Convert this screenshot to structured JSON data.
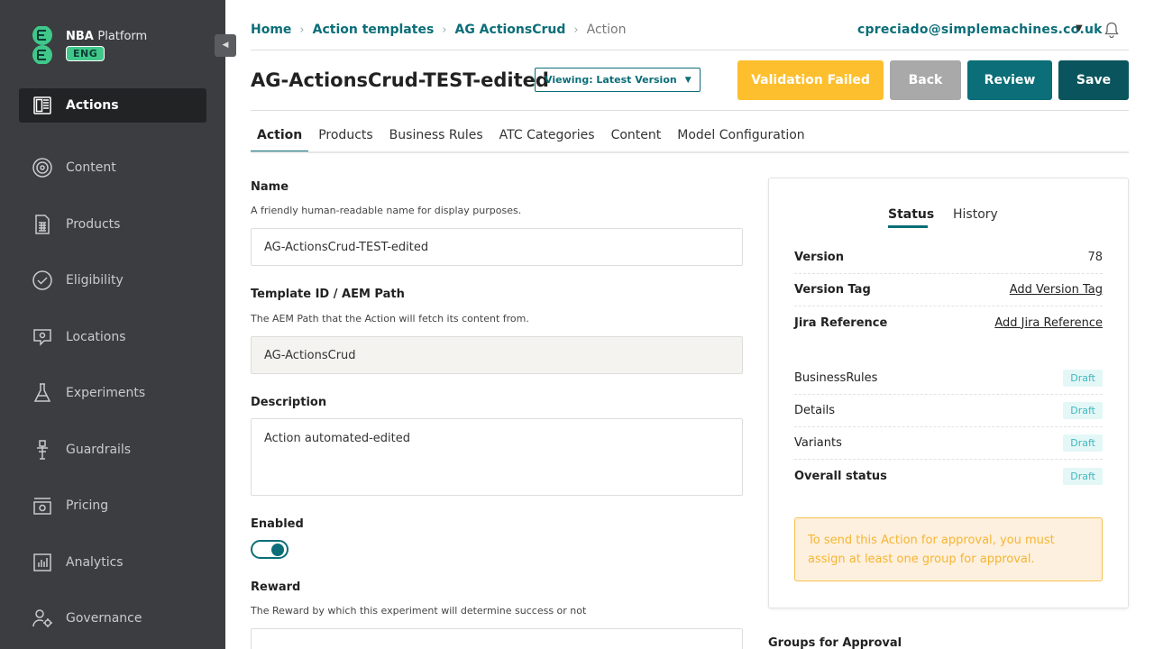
{
  "brand": {
    "name_bold": "NBA",
    "name_light": "Platform",
    "badge": "ENG"
  },
  "sidebar": {
    "items": [
      {
        "label": "Actions",
        "icon": "actions-icon",
        "active": true
      },
      {
        "label": "Content",
        "icon": "content-icon"
      },
      {
        "label": "Products",
        "icon": "products-icon"
      },
      {
        "label": "Eligibility",
        "icon": "eligibility-icon"
      },
      {
        "label": "Locations",
        "icon": "locations-icon"
      },
      {
        "label": "Experiments",
        "icon": "experiments-icon"
      },
      {
        "label": "Guardrails",
        "icon": "guardrails-icon"
      },
      {
        "label": "Pricing",
        "icon": "pricing-icon"
      },
      {
        "label": "Analytics",
        "icon": "analytics-icon"
      },
      {
        "label": "Governance",
        "icon": "governance-icon"
      }
    ]
  },
  "breadcrumb": {
    "items": [
      "Home",
      "Action templates",
      "AG ActionsCrud"
    ],
    "current": "Action"
  },
  "user": {
    "email": "cpreciado@simplemachines.co.uk"
  },
  "page": {
    "title": "AG-ActionsCrud-TEST-edited",
    "version_select": "Viewing: Latest Version"
  },
  "buttons": {
    "validation": "Validation Failed",
    "back": "Back",
    "review": "Review",
    "save": "Save"
  },
  "tabs": [
    "Action",
    "Products",
    "Business Rules",
    "ATC Categories",
    "Content",
    "Model Configuration"
  ],
  "form": {
    "name": {
      "label": "Name",
      "help": "A friendly human-readable name for display purposes.",
      "value": "AG-ActionsCrud-TEST-edited"
    },
    "template": {
      "label": "Template ID / AEM Path",
      "help": "The AEM Path that the Action will fetch its content from.",
      "value": "AG-ActionsCrud"
    },
    "description": {
      "label": "Description",
      "value": "Action automated-edited"
    },
    "enabled": {
      "label": "Enabled",
      "on": true
    },
    "reward": {
      "label": "Reward",
      "help": "The Reward by which this experiment will determine success or not"
    }
  },
  "status_panel": {
    "tabs": [
      "Status",
      "History"
    ],
    "version": {
      "label": "Version",
      "value": "78"
    },
    "version_tag": {
      "label": "Version Tag",
      "link": "Add Version Tag"
    },
    "jira": {
      "label": "Jira Reference",
      "link": "Add Jira Reference"
    },
    "statuses": [
      {
        "label": "BusinessRules",
        "badge": "Draft"
      },
      {
        "label": "Details",
        "badge": "Draft"
      },
      {
        "label": "Variants",
        "badge": "Draft"
      },
      {
        "label": "Overall status",
        "badge": "Draft"
      }
    ],
    "notice": "To send this Action for approval, you must assign at least one group for approval."
  },
  "groups_label": "Groups for Approval",
  "colors": {
    "accent": "#0b6e78",
    "sidebar": "#3b3d40",
    "warning": "#fdbf2d",
    "brand_green": "#3fc88a"
  }
}
